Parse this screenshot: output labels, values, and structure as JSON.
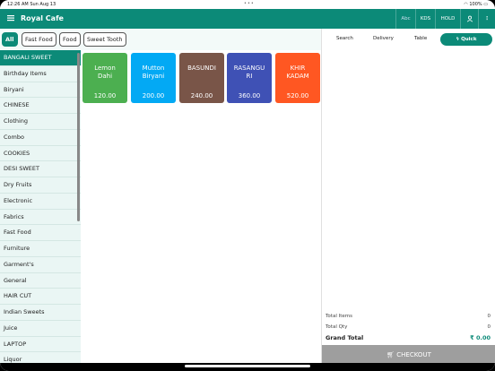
{
  "status": {
    "time": "12:26 AM",
    "date": "Sun Aug 13",
    "battery": "100%"
  },
  "app": {
    "title": "Royal Cafe"
  },
  "toolbar": {
    "abc": "Abc",
    "kds": "KDS",
    "hold": "HOLD"
  },
  "chips": [
    "All",
    "Fast Food",
    "Food",
    "Sweet Tooth"
  ],
  "sidebar": [
    "BANGALI SWEET",
    "Birthday Items",
    "Biryani",
    "CHINESE",
    "Clothing",
    "Combo",
    "COOKIES",
    "DESI SWEET",
    "Dry Fruits",
    "Electronic",
    "Fabrics",
    "Fast Food",
    "Furniture",
    "Garment's",
    "General",
    "HAIR CUT",
    "Indian Sweets",
    "Juice",
    "LAPTOP",
    "Liquor"
  ],
  "items": [
    {
      "name": "Lemon\nDahi",
      "price": "120.00",
      "color": "#4caf50"
    },
    {
      "name": "Mutton\nBiryani",
      "price": "200.00",
      "color": "#03a9f4"
    },
    {
      "name": "BASUNDI",
      "price": "240.00",
      "color": "#795548"
    },
    {
      "name": "RASANGU\nRI",
      "price": "360.00",
      "color": "#3f51b5"
    },
    {
      "name": "KHIR\nKADAM",
      "price": "520.00",
      "color": "#ff5722"
    }
  ],
  "cart": {
    "tabs": [
      "Search",
      "Delivery",
      "Table"
    ],
    "quick": "Quick",
    "total_items_label": "Total Items",
    "total_items": "0",
    "total_qty_label": "Total Qty",
    "total_qty": "0",
    "grand_total_label": "Grand Total",
    "grand_total": "₹ 0.00",
    "checkout": "CHECKOUT"
  }
}
